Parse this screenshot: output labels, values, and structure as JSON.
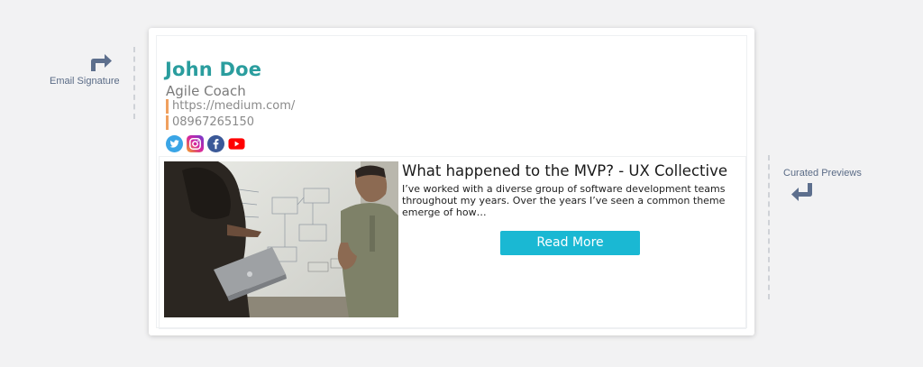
{
  "annotations": {
    "left_label": "Email Signature",
    "right_label": "Curated Previews"
  },
  "signature": {
    "name": "John Doe",
    "title": "Agile Coach",
    "url": "https://medium.com/",
    "phone": "08967265150",
    "name_color": "#2a9d9e",
    "accent_color": "#f0a05f",
    "socials": [
      "twitter-icon",
      "instagram-icon",
      "facebook-icon",
      "youtube-icon"
    ]
  },
  "preview": {
    "title": "What happened to the MVP? - UX Collective",
    "description": "I’ve worked with a diverse group of software development teams throughout my years. Over the years I’ve seen a common theme emerge of how…",
    "button_label": "Read More",
    "button_color": "#1ab8d3"
  }
}
